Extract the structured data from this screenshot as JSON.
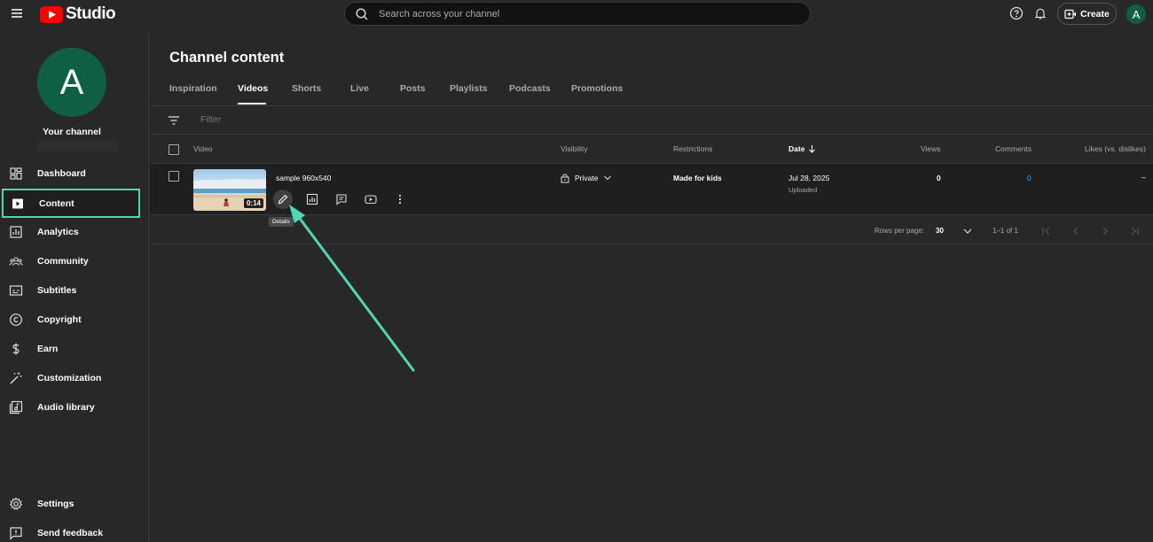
{
  "header": {
    "logo_text": "Studio",
    "search_placeholder": "Search across your channel",
    "create_label": "Create",
    "avatar_letter": "A",
    "icons": [
      "menu-icon",
      "help-icon",
      "notifications-icon",
      "create-video-icon"
    ]
  },
  "sidebar": {
    "avatar_letter": "A",
    "channel_label": "Your channel",
    "items": [
      {
        "label": "Dashboard",
        "icon": "dashboard-icon"
      },
      {
        "label": "Content",
        "icon": "content-icon",
        "active": true
      },
      {
        "label": "Analytics",
        "icon": "analytics-icon"
      },
      {
        "label": "Community",
        "icon": "community-icon"
      },
      {
        "label": "Subtitles",
        "icon": "subtitles-icon"
      },
      {
        "label": "Copyright",
        "icon": "copyright-icon"
      },
      {
        "label": "Earn",
        "icon": "earn-icon"
      },
      {
        "label": "Customization",
        "icon": "customization-icon"
      },
      {
        "label": "Audio library",
        "icon": "audio-library-icon"
      }
    ],
    "bottom_items": [
      {
        "label": "Settings",
        "icon": "settings-icon"
      },
      {
        "label": "Send feedback",
        "icon": "feedback-icon"
      }
    ]
  },
  "main": {
    "title": "Channel content",
    "tabs": [
      {
        "label": "Inspiration"
      },
      {
        "label": "Videos",
        "active": true
      },
      {
        "label": "Shorts"
      },
      {
        "label": "Live"
      },
      {
        "label": "Posts"
      },
      {
        "label": "Playlists"
      },
      {
        "label": "Podcasts"
      },
      {
        "label": "Promotions"
      }
    ],
    "filter_placeholder": "Filter",
    "columns": {
      "video": "Video",
      "visibility": "Visibility",
      "restrictions": "Restrictions",
      "date": "Date",
      "views": "Views",
      "comments": "Comments",
      "likes": "Likes (vs. dislikes)"
    },
    "rows": [
      {
        "title": "sample 960x540",
        "duration": "0:14",
        "visibility": "Private",
        "restrictions": "Made for kids",
        "date": "Jul 28, 2025",
        "date_status": "Uploaded",
        "views": "0",
        "comments": "0",
        "likes": "–",
        "actions": [
          "details-icon",
          "analytics-icon",
          "comments-icon",
          "youtube-icon",
          "more-options-icon"
        ],
        "tooltip": "Details"
      }
    ],
    "pagination": {
      "rows_per_page_label": "Rows per page:",
      "rows_per_page_value": "30",
      "range": "1–1 of 1"
    }
  },
  "colors": {
    "background": "#282828",
    "row_background": "#1f1f1f",
    "highlight": "#4dd8b4",
    "link_blue": "#3ea6ff",
    "avatar": "#0f5f45",
    "youtube_red": "#ff0000"
  }
}
